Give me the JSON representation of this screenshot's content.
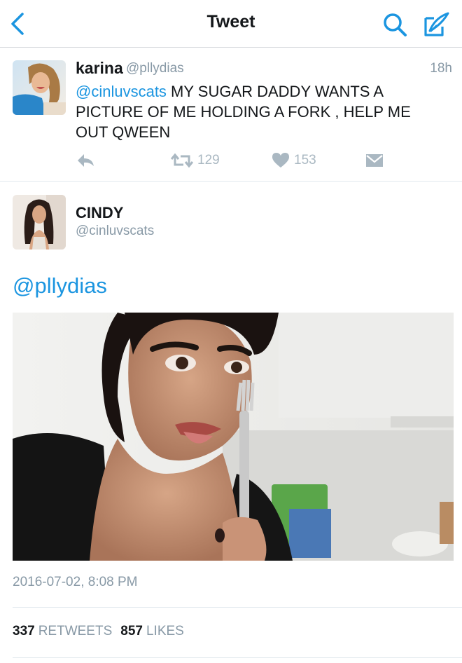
{
  "navbar": {
    "title": "Tweet",
    "back_icon": "back-chevron-icon",
    "search_icon": "search-icon",
    "compose_icon": "compose-tweet-icon",
    "accent": "#1b95e0"
  },
  "reply_tweet": {
    "name": "karina",
    "handle": "@pllydias",
    "time": "18h",
    "mention": "@cinluvscats",
    "text": " MY SUGAR DADDY WANTS A PICTURE OF ME HOLDING A FORK , HELP ME OUT QWEEN",
    "actions": {
      "reply_icon": "reply-icon",
      "retweet_icon": "retweet-icon",
      "retweet_count": "129",
      "like_icon": "heart-icon",
      "like_count": "153",
      "dm_icon": "envelope-icon"
    }
  },
  "main_tweet": {
    "name": "CINDY",
    "handle": "@cinluvscats",
    "text": "@pllydias",
    "timestamp": "2016-07-02, 8:08 PM",
    "stats": {
      "retweets_count": "337",
      "retweets_label": "RETWEETS",
      "likes_count": "857",
      "likes_label": "LIKES"
    }
  },
  "colors": {
    "link": "#1b95e0",
    "muted": "#8899a6",
    "icon": "#aab8c2",
    "text": "#14171a",
    "divider": "#e1e8ed"
  }
}
